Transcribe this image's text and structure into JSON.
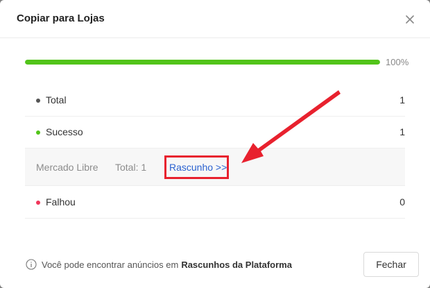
{
  "dialog": {
    "title": "Copiar para Lojas"
  },
  "progress": {
    "percent": 100,
    "label": "100%",
    "color": "#52c41a"
  },
  "rows": {
    "total": {
      "label": "Total",
      "count": "1",
      "dot_color": "#555555"
    },
    "success": {
      "label": "Sucesso",
      "count": "1",
      "dot_color": "#52c41a"
    },
    "platform": {
      "name": "Mercado Libre",
      "total": "Total: 1",
      "link": "Rascunho >>"
    },
    "failed": {
      "label": "Falhou",
      "count": "0",
      "dot_color": "#f0365a"
    }
  },
  "footer": {
    "note_prefix": "Você pode encontrar anúncios em",
    "note_bold": "Rascunhos da Plataforma",
    "close_label": "Fechar"
  },
  "annotation": {
    "color": "#e8212e"
  },
  "icons": {
    "close": "close-icon",
    "info": "info-icon"
  }
}
